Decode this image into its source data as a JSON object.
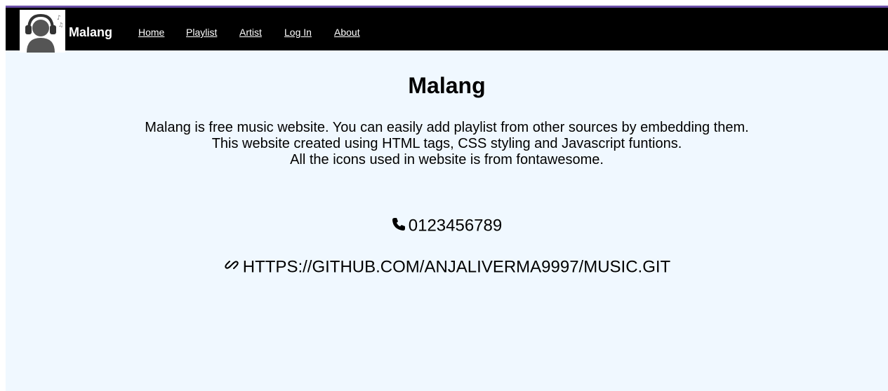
{
  "navbar": {
    "brand": "Malang",
    "links": [
      {
        "label": "Home"
      },
      {
        "label": "Playlist"
      },
      {
        "label": "Artist"
      },
      {
        "label": "Log In"
      },
      {
        "label": "About"
      }
    ],
    "accent_color": "#6b4fa8",
    "background_color": "#000000"
  },
  "main": {
    "title": "Malang",
    "description_lines": [
      "Malang is free music website. You can easily add playlist from other sources by embedding them.",
      "This website created using HTML tags, CSS styling and Javascript funtions.",
      "All the icons used in website is from fontawesome."
    ],
    "phone": {
      "icon": "phone-icon",
      "value": "0123456789"
    },
    "repo": {
      "icon": "link-icon",
      "value": "HTTPS://GITHUB.COM/ANJALIVERMA9997/MUSIC.GIT"
    },
    "background_color": "#f0f8ff"
  }
}
